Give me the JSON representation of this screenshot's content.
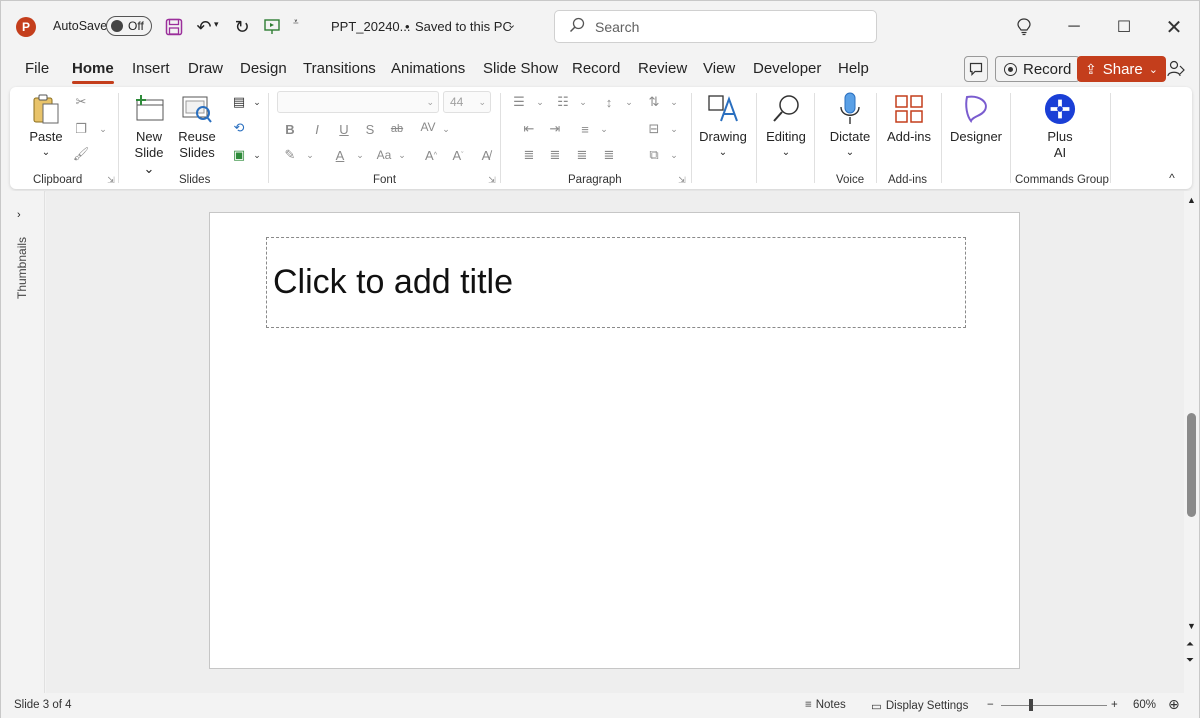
{
  "titlebar": {
    "app_logo_letter": "P",
    "autosave_label": "AutoSave",
    "autosave_state": "Off",
    "filename": "PPT_20240...",
    "save_status": "Saved to this PC",
    "search_placeholder": "Search",
    "icons": [
      "save-icon",
      "undo-icon",
      "redo-icon",
      "present-icon",
      "customize-icon",
      "lightbulb-icon",
      "minimize-icon",
      "maximize-icon",
      "close-icon"
    ]
  },
  "menu": {
    "tabs": [
      "File",
      "Home",
      "Insert",
      "Draw",
      "Design",
      "Transitions",
      "Animations",
      "Slide Show",
      "Record",
      "Review",
      "View",
      "Developer",
      "Help"
    ],
    "active_tab": "Home",
    "record_label": "Record",
    "share_label": "Share"
  },
  "ribbon": {
    "clipboard": {
      "label": "Clipboard",
      "paste": "Paste"
    },
    "slides": {
      "label": "Slides",
      "new_slide_1": "New",
      "new_slide_2": "Slide",
      "reuse_1": "Reuse",
      "reuse_2": "Slides"
    },
    "font": {
      "label": "Font",
      "size": "44",
      "bold": "B",
      "italic": "I",
      "underline": "U",
      "strike": "S",
      "abc": "ab",
      "av": "AV",
      "aa": "Aa"
    },
    "paragraph": {
      "label": "Paragraph"
    },
    "drawing": {
      "label": "Drawing"
    },
    "editing": {
      "label": "Editing"
    },
    "voice": {
      "label": "Voice",
      "dictate": "Dictate"
    },
    "addins": {
      "label": "Add-ins",
      "button": "Add-ins"
    },
    "designer": {
      "button": "Designer"
    },
    "commands": {
      "label": "Commands Group",
      "plus_1": "Plus",
      "plus_2": "AI"
    }
  },
  "leftpane": {
    "label": "Thumbnails"
  },
  "slide": {
    "title_placeholder": "Click to add title"
  },
  "status": {
    "slide_counter": "Slide 3 of 4",
    "notes": "Notes",
    "display_settings": "Display Settings",
    "zoom": "60%"
  },
  "colors": {
    "accent": "#c43e1c",
    "ribbon_bg": "#ffffff",
    "window_bg": "#f3f3f3"
  }
}
